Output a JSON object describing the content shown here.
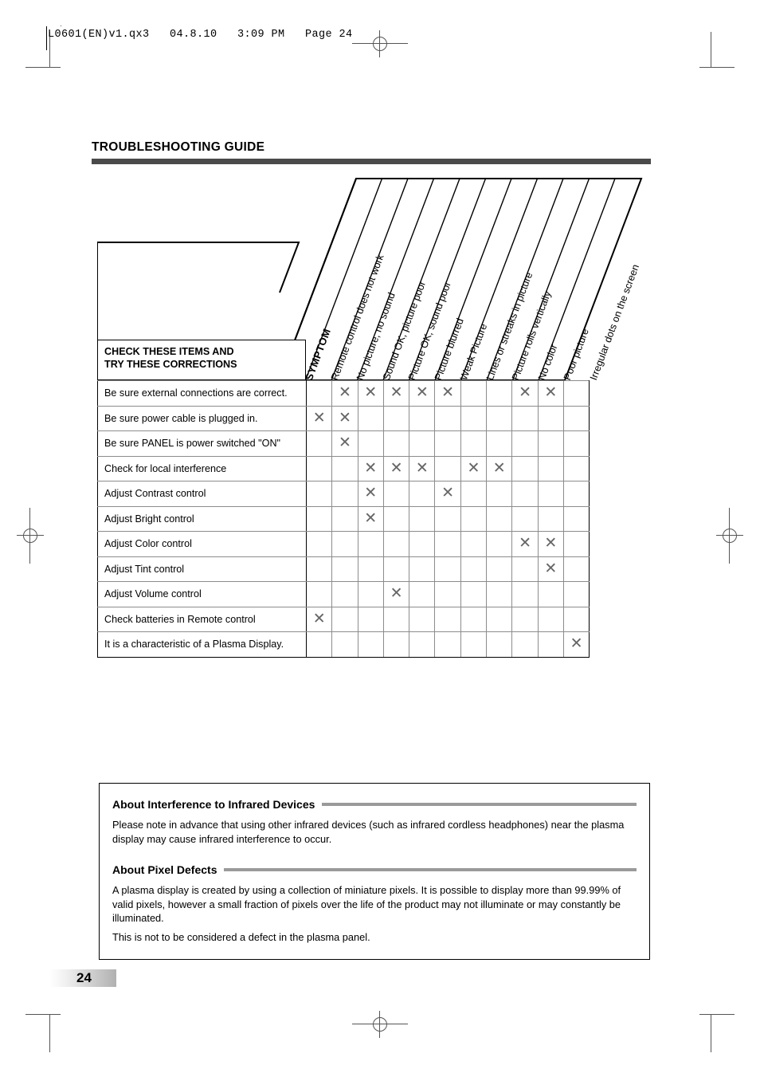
{
  "film_header": {
    "text": "L0601(EN)v1.qx3   04.8.10   3:09 PM   Page 24"
  },
  "page": {
    "title": "TROUBLESHOOTING GUIDE",
    "number": "24"
  },
  "matrix": {
    "symptom_label": "SYMPTOM",
    "corner_label_line1": "CHECK THESE ITEMS AND",
    "corner_label_line2": "TRY THESE CORRECTIONS",
    "columns": [
      "Remote control does not work",
      "No picture, no sound",
      "Sound OK, picture poor",
      "Picture OK, sound poor",
      "Picture blurred",
      "Weak Picture",
      "Lines or streaks in picture",
      "Picture rolls vertically",
      "No color",
      "Poor picture",
      "Irregular dots on the screen"
    ],
    "mark_glyph": "✕",
    "mark_color": "#666666",
    "rows": [
      {
        "label": "Be sure external connections are correct.",
        "marks": [
          0,
          1,
          1,
          1,
          1,
          1,
          0,
          0,
          1,
          1,
          0
        ]
      },
      {
        "label": "Be sure power cable is plugged in.",
        "marks": [
          1,
          1,
          0,
          0,
          0,
          0,
          0,
          0,
          0,
          0,
          0
        ]
      },
      {
        "label": "Be sure PANEL is power switched \"ON\"",
        "marks": [
          0,
          1,
          0,
          0,
          0,
          0,
          0,
          0,
          0,
          0,
          0
        ]
      },
      {
        "label": "Check for local interference",
        "marks": [
          0,
          0,
          1,
          1,
          1,
          0,
          1,
          1,
          0,
          0,
          0
        ]
      },
      {
        "label": "Adjust Contrast control",
        "marks": [
          0,
          0,
          1,
          0,
          0,
          1,
          0,
          0,
          0,
          0,
          0
        ]
      },
      {
        "label": "Adjust Bright control",
        "marks": [
          0,
          0,
          1,
          0,
          0,
          0,
          0,
          0,
          0,
          0,
          0
        ]
      },
      {
        "label": "Adjust Color control",
        "marks": [
          0,
          0,
          0,
          0,
          0,
          0,
          0,
          0,
          1,
          1,
          0
        ]
      },
      {
        "label": "Adjust Tint control",
        "marks": [
          0,
          0,
          0,
          0,
          0,
          0,
          0,
          0,
          0,
          1,
          0
        ]
      },
      {
        "label": "Adjust Volume control",
        "marks": [
          0,
          0,
          0,
          1,
          0,
          0,
          0,
          0,
          0,
          0,
          0
        ]
      },
      {
        "label": "Check batteries in Remote control",
        "marks": [
          1,
          0,
          0,
          0,
          0,
          0,
          0,
          0,
          0,
          0,
          0
        ]
      },
      {
        "label": "It is a characteristic of a Plasma Display.",
        "marks": [
          0,
          0,
          0,
          0,
          0,
          0,
          0,
          0,
          0,
          0,
          1
        ]
      }
    ]
  },
  "notes": {
    "section1": {
      "heading": "About Interference to Infrared Devices",
      "body": "Please note in advance that using other infrared devices (such as infrared cordless headphones) near the plasma display may cause infrared interference to occur."
    },
    "section2": {
      "heading": "About Pixel Defects",
      "body1": "A plasma display is created by using a collection of miniature pixels. It is possible to display more than 99.99% of valid pixels, however a small fraction of pixels over the life of the product may not illuminate or may constantly be illuminated.",
      "body2": "This is not to be considered a defect in the plasma panel."
    }
  }
}
